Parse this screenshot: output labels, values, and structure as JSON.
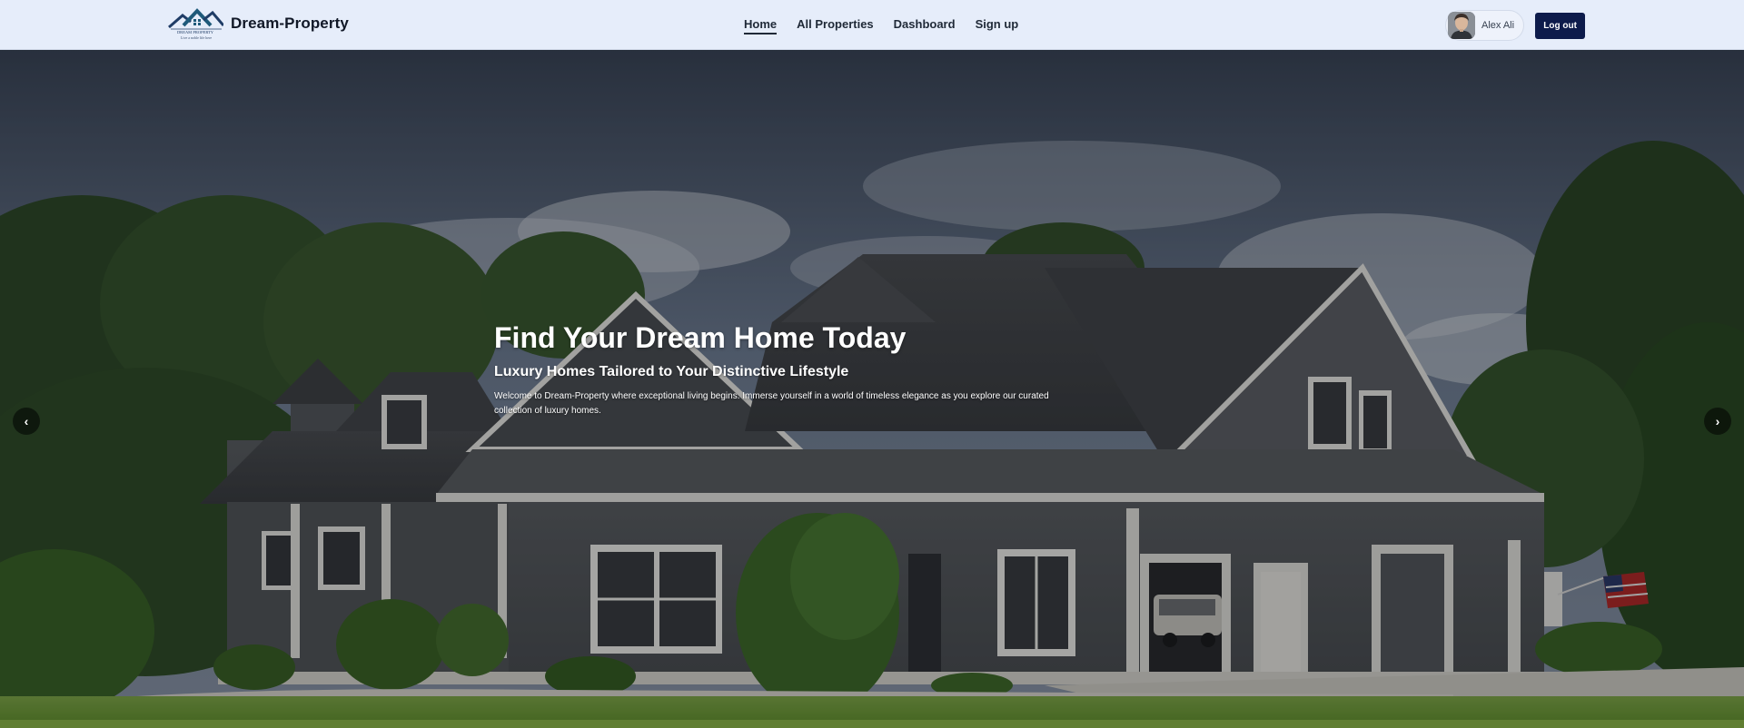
{
  "brand": {
    "name": "Dream-Property",
    "logo_text": "DREAM PROPERTY",
    "logo_tagline": "Live a noble life here"
  },
  "nav": {
    "links": [
      {
        "label": "Home",
        "active": true
      },
      {
        "label": "All Properties",
        "active": false
      },
      {
        "label": "Dashboard",
        "active": false
      },
      {
        "label": "Sign up",
        "active": false
      }
    ]
  },
  "user": {
    "name": "Alex Ali",
    "logout_label": "Log out"
  },
  "hero": {
    "title": "Find Your Dream Home Today",
    "subtitle": "Luxury Homes Tailored to Your Distinctive Lifestyle",
    "description": "Welcome to Dream-Property where exceptional living begins. Immerse yourself in a world of timeless elegance as you explore our curated collection of luxury homes.",
    "prev_icon": "chevron-left-icon",
    "next_icon": "chevron-right-icon"
  },
  "colors": {
    "navbar_bg": "#e6edfa",
    "logout_bg": "#0d1b4b",
    "logo_blue": "#1f5a7a"
  }
}
